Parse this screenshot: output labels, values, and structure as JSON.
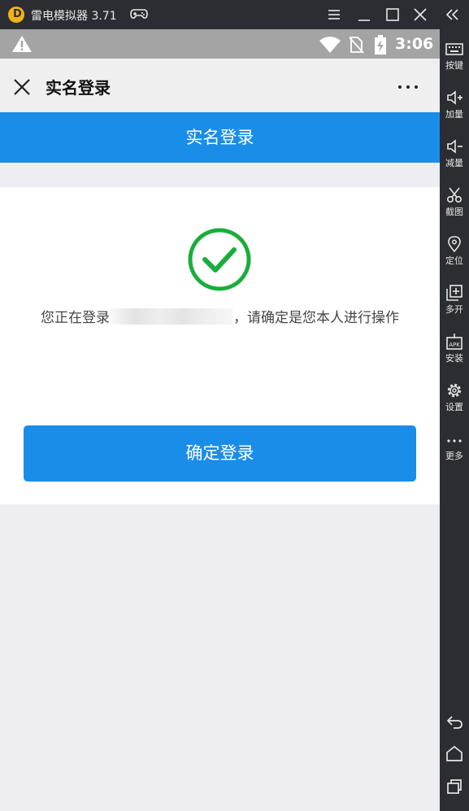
{
  "emulator": {
    "title": "雷电模拟器 3.71",
    "sidebar": [
      {
        "label": "按键",
        "icon": "keyboard-icon"
      },
      {
        "label": "加量",
        "icon": "volume-up-icon"
      },
      {
        "label": "减量",
        "icon": "volume-down-icon"
      },
      {
        "label": "截图",
        "icon": "scissors-icon"
      },
      {
        "label": "定位",
        "icon": "location-pin-icon"
      },
      {
        "label": "多开",
        "icon": "multi-instance-icon"
      },
      {
        "label": "安装",
        "icon": "apk-install-icon"
      },
      {
        "label": "设置",
        "icon": "gear-icon"
      },
      {
        "label": "更多",
        "icon": "more-dots-icon"
      }
    ]
  },
  "status_bar": {
    "time": "3:06"
  },
  "header": {
    "title": "实名登录"
  },
  "banner": {
    "title": "实名登录"
  },
  "content": {
    "message_prefix": "您正在登录",
    "message_suffix": "，请确定是您本人进行操作",
    "confirm_label": "确定登录"
  },
  "colors": {
    "primary": "#1a8de9",
    "success": "#1aad3c",
    "emulator_bg": "#2b2d33",
    "status_bar": "#a4a4a4"
  }
}
